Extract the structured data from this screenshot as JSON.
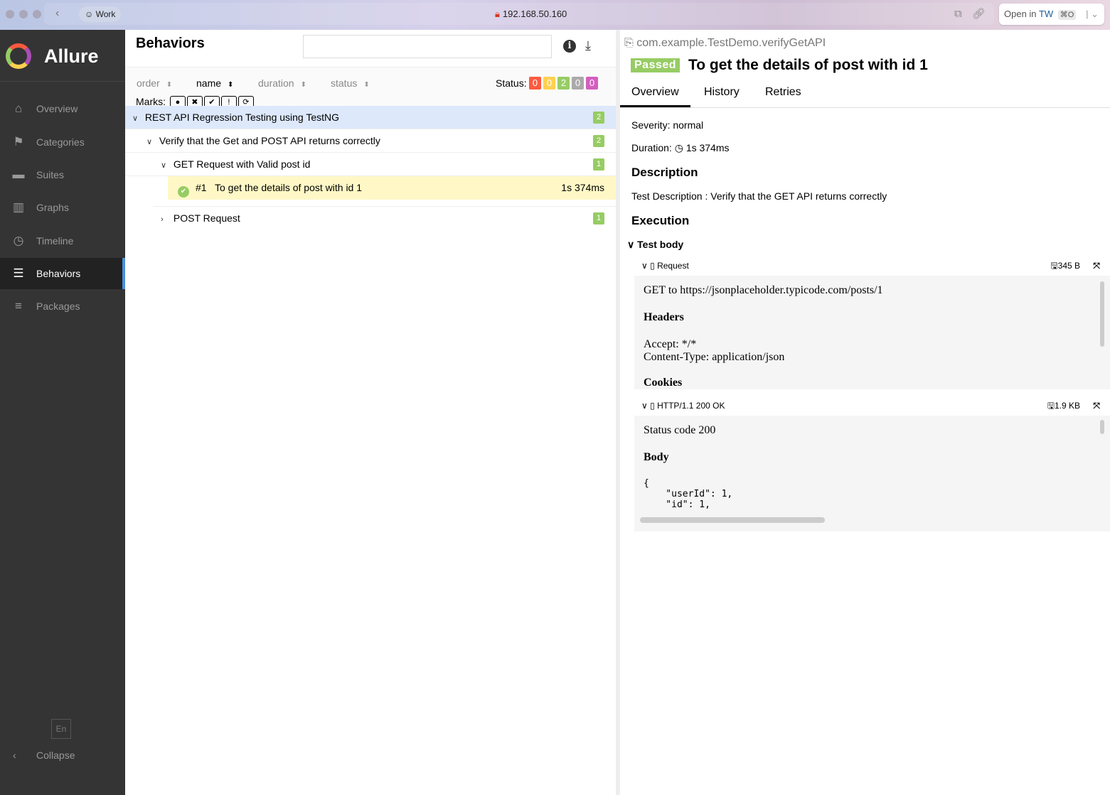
{
  "browser": {
    "profile": "Work",
    "url": "192.168.50.160",
    "open_in_label": "Open in",
    "open_in_app": "TW",
    "shortcut": "⌘O"
  },
  "sidebar": {
    "brand": "Allure",
    "items": [
      {
        "label": "Overview",
        "icon": "home-icon"
      },
      {
        "label": "Categories",
        "icon": "flag-icon"
      },
      {
        "label": "Suites",
        "icon": "briefcase-icon"
      },
      {
        "label": "Graphs",
        "icon": "bar-chart-icon"
      },
      {
        "label": "Timeline",
        "icon": "clock-icon"
      },
      {
        "label": "Behaviors",
        "icon": "list-icon",
        "active": true
      },
      {
        "label": "Packages",
        "icon": "align-left-icon"
      }
    ],
    "language": "En",
    "collapse": "Collapse"
  },
  "behaviors": {
    "title": "Behaviors",
    "search_value": "",
    "sort": [
      "order",
      "name",
      "duration",
      "status"
    ],
    "status_label": "Status:",
    "status_counts": [
      {
        "value": "0",
        "color": "#fd5a3e"
      },
      {
        "value": "0",
        "color": "#ffd050"
      },
      {
        "value": "2",
        "color": "#97cc64"
      },
      {
        "value": "0",
        "color": "#aaaaaa"
      },
      {
        "value": "0",
        "color": "#d35ebe"
      }
    ],
    "marks_label": "Marks:",
    "tree": {
      "epic": {
        "name": "REST API Regression Testing using TestNG",
        "count": "2"
      },
      "feature": {
        "name": "Verify that the Get and POST API returns correctly",
        "count": "2"
      },
      "story1": {
        "name": "GET Request with Valid post id",
        "count": "1"
      },
      "test": {
        "order": "#1",
        "name": "To get the details of post with id 1",
        "duration": "1s 374ms"
      },
      "story2": {
        "name": "POST Request",
        "count": "1"
      }
    }
  },
  "detail": {
    "full_name": "com.example.TestDemo.verifyGetAPI",
    "status": "Passed",
    "title": "To get the details of post with id 1",
    "tabs": [
      "Overview",
      "History",
      "Retries"
    ],
    "severity": "Severity: normal",
    "duration_label": "Duration:",
    "duration": "1s 374ms",
    "description_heading": "Description",
    "description": "Test Description : Verify that the GET API returns correctly",
    "execution_heading": "Execution",
    "test_body": "Test body",
    "request": {
      "name": "Request",
      "size": "345 B",
      "line": "GET to https://jsonplaceholder.typicode.com/posts/1",
      "headers_heading": "Headers",
      "headers": [
        "Accept: */*",
        "Content-Type: application/json"
      ],
      "cut_heading": "Cookies"
    },
    "response": {
      "name": "HTTP/1.1 200 OK",
      "size": "1.9 KB",
      "status": "Status code 200",
      "body_heading": "Body",
      "body": "{\n    \"userId\": 1,\n    \"id\": 1,"
    }
  }
}
